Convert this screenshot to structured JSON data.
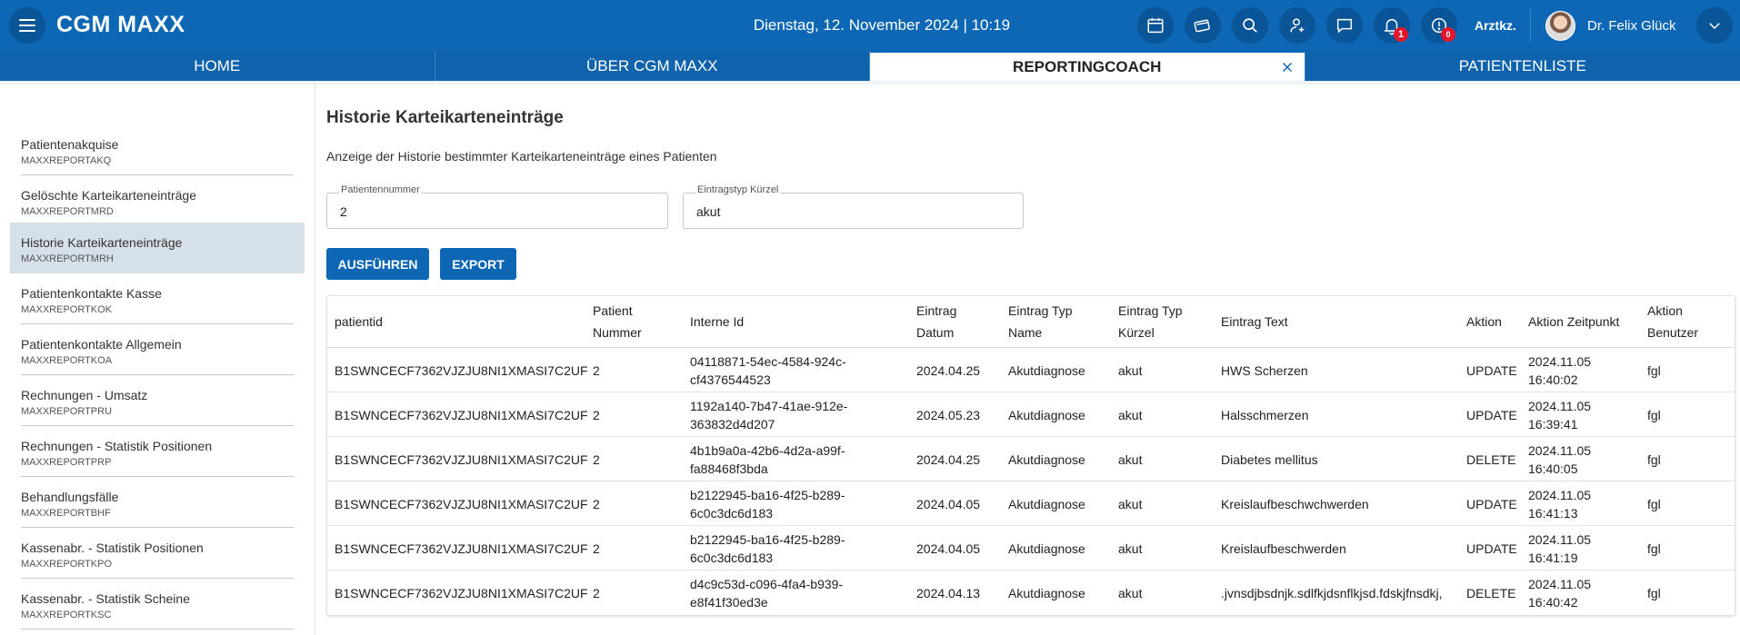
{
  "header": {
    "logo": "CGM MAXX",
    "datetime": "Dienstag, 12. November 2024 | 10:19",
    "notification_count": "1",
    "info_badge": "0",
    "arztkz": "Arztkz.",
    "user_name": "Dr. Felix Glück",
    "icons": [
      "calendar-icon",
      "card-icon",
      "search-icon",
      "add-person-icon",
      "chat-icon",
      "bell-icon",
      "info-icon"
    ]
  },
  "tabs": [
    {
      "label": "HOME"
    },
    {
      "label": "ÜBER CGM MAXX"
    },
    {
      "label": "REPORTINGCOACH",
      "active": true
    },
    {
      "label": "PATIENTENLISTE"
    }
  ],
  "sidebar": {
    "items": [
      {
        "title": "Patientenakquise",
        "code": "MAXXREPORTAKQ"
      },
      {
        "title": "Gelöschte Karteikarteneinträge",
        "code": "MAXXREPORTMRD"
      },
      {
        "title": "Historie Karteikarteneinträge",
        "code": "MAXXREPORTMRH",
        "active": true
      },
      {
        "title": "Patientenkontakte Kasse",
        "code": "MAXXREPORTKOK"
      },
      {
        "title": "Patientenkontakte Allgemein",
        "code": "MAXXREPORTKOA"
      },
      {
        "title": "Rechnungen - Umsatz",
        "code": "MAXXREPORTPRU"
      },
      {
        "title": "Rechnungen - Statistik Positionen",
        "code": "MAXXREPORTPRP"
      },
      {
        "title": "Behandlungsfälle",
        "code": "MAXXREPORTBHF"
      },
      {
        "title": "Kassenabr. - Statistik Positionen",
        "code": "MAXXREPORTKPO"
      },
      {
        "title": "Kassenabr. - Statistik Scheine",
        "code": "MAXXREPORTKSC"
      }
    ]
  },
  "main": {
    "title": "Historie Karteikarteneinträge",
    "description": "Anzeige der Historie bestimmter Karteikarteneinträge eines Patienten",
    "fields": {
      "patient_number": {
        "label": "Patientennummer",
        "value": "2"
      },
      "entry_type": {
        "label": "Eintragstyp Kürzel",
        "value": "akut"
      }
    },
    "buttons": {
      "run": "AUSFÜHREN",
      "export": "EXPORT"
    }
  },
  "table": {
    "columns": [
      {
        "l1": "patientid",
        "l2": ""
      },
      {
        "l1": "Patient",
        "l2": "Nummer"
      },
      {
        "l1": "Interne Id",
        "l2": ""
      },
      {
        "l1": "Eintrag",
        "l2": "Datum"
      },
      {
        "l1": "Eintrag Typ",
        "l2": "Name"
      },
      {
        "l1": "Eintrag Typ",
        "l2": "Kürzel"
      },
      {
        "l1": "Eintrag Text",
        "l2": ""
      },
      {
        "l1": "Aktion",
        "l2": ""
      },
      {
        "l1": "Aktion Zeitpunkt",
        "l2": ""
      },
      {
        "l1": "Aktion",
        "l2": "Benutzer"
      }
    ],
    "rows": [
      {
        "patientid": "B1SWNCECF7362VJZJU8NI1XMASI7C2UF",
        "nummer": "2",
        "id1": "04118871-54ec-4584-924c-",
        "id2": "cf4376544523",
        "datum": "2024.04.25",
        "typname": "Akutdiagnose",
        "kuerzel": "akut",
        "text": "HWS Scherzen",
        "aktion": "UPDATE",
        "zp1": "2024.11.05",
        "zp2": "16:40:02",
        "benutzer": "fgl"
      },
      {
        "patientid": "B1SWNCECF7362VJZJU8NI1XMASI7C2UF",
        "nummer": "2",
        "id1": "1192a140-7b47-41ae-912e-",
        "id2": "363832d4d207",
        "datum": "2024.05.23",
        "typname": "Akutdiagnose",
        "kuerzel": "akut",
        "text": "Halsschmerzen",
        "aktion": "UPDATE",
        "zp1": "2024.11.05",
        "zp2": "16:39:41",
        "benutzer": "fgl"
      },
      {
        "patientid": "B1SWNCECF7362VJZJU8NI1XMASI7C2UF",
        "nummer": "2",
        "id1": "4b1b9a0a-42b6-4d2a-a99f-",
        "id2": "fa88468f3bda",
        "datum": "2024.04.25",
        "typname": "Akutdiagnose",
        "kuerzel": "akut",
        "text": "Diabetes mellitus",
        "aktion": "DELETE",
        "zp1": "2024.11.05",
        "zp2": "16:40:05",
        "benutzer": "fgl"
      },
      {
        "patientid": "B1SWNCECF7362VJZJU8NI1XMASI7C2UF",
        "nummer": "2",
        "id1": "b2122945-ba16-4f25-b289-",
        "id2": "6c0c3dc6d183",
        "datum": "2024.04.05",
        "typname": "Akutdiagnose",
        "kuerzel": "akut",
        "text": "Kreislaufbeschwchwerden",
        "aktion": "UPDATE",
        "zp1": "2024.11.05",
        "zp2": "16:41:13",
        "benutzer": "fgl"
      },
      {
        "patientid": "B1SWNCECF7362VJZJU8NI1XMASI7C2UF",
        "nummer": "2",
        "id1": "b2122945-ba16-4f25-b289-",
        "id2": "6c0c3dc6d183",
        "datum": "2024.04.05",
        "typname": "Akutdiagnose",
        "kuerzel": "akut",
        "text": "Kreislaufbeschwerden",
        "aktion": "UPDATE",
        "zp1": "2024.11.05",
        "zp2": "16:41:19",
        "benutzer": "fgl"
      },
      {
        "patientid": "B1SWNCECF7362VJZJU8NI1XMASI7C2UF",
        "nummer": "2",
        "id1": "d4c9c53d-c096-4fa4-b939-",
        "id2": "e8f41f30ed3e",
        "datum": "2024.04.13",
        "typname": "Akutdiagnose",
        "kuerzel": "akut",
        "text": ".jvnsdjbsdnjk.sdlfkjdsnflkjsd.fdskjfnsdkj,",
        "aktion": "DELETE",
        "zp1": "2024.11.05",
        "zp2": "16:40:42",
        "benutzer": "fgl"
      }
    ]
  },
  "colors": {
    "brand": "#0d67b5",
    "brand_dark": "#0a5498",
    "badge": "#e3172b",
    "sidebar_active": "#d6e0e8"
  }
}
